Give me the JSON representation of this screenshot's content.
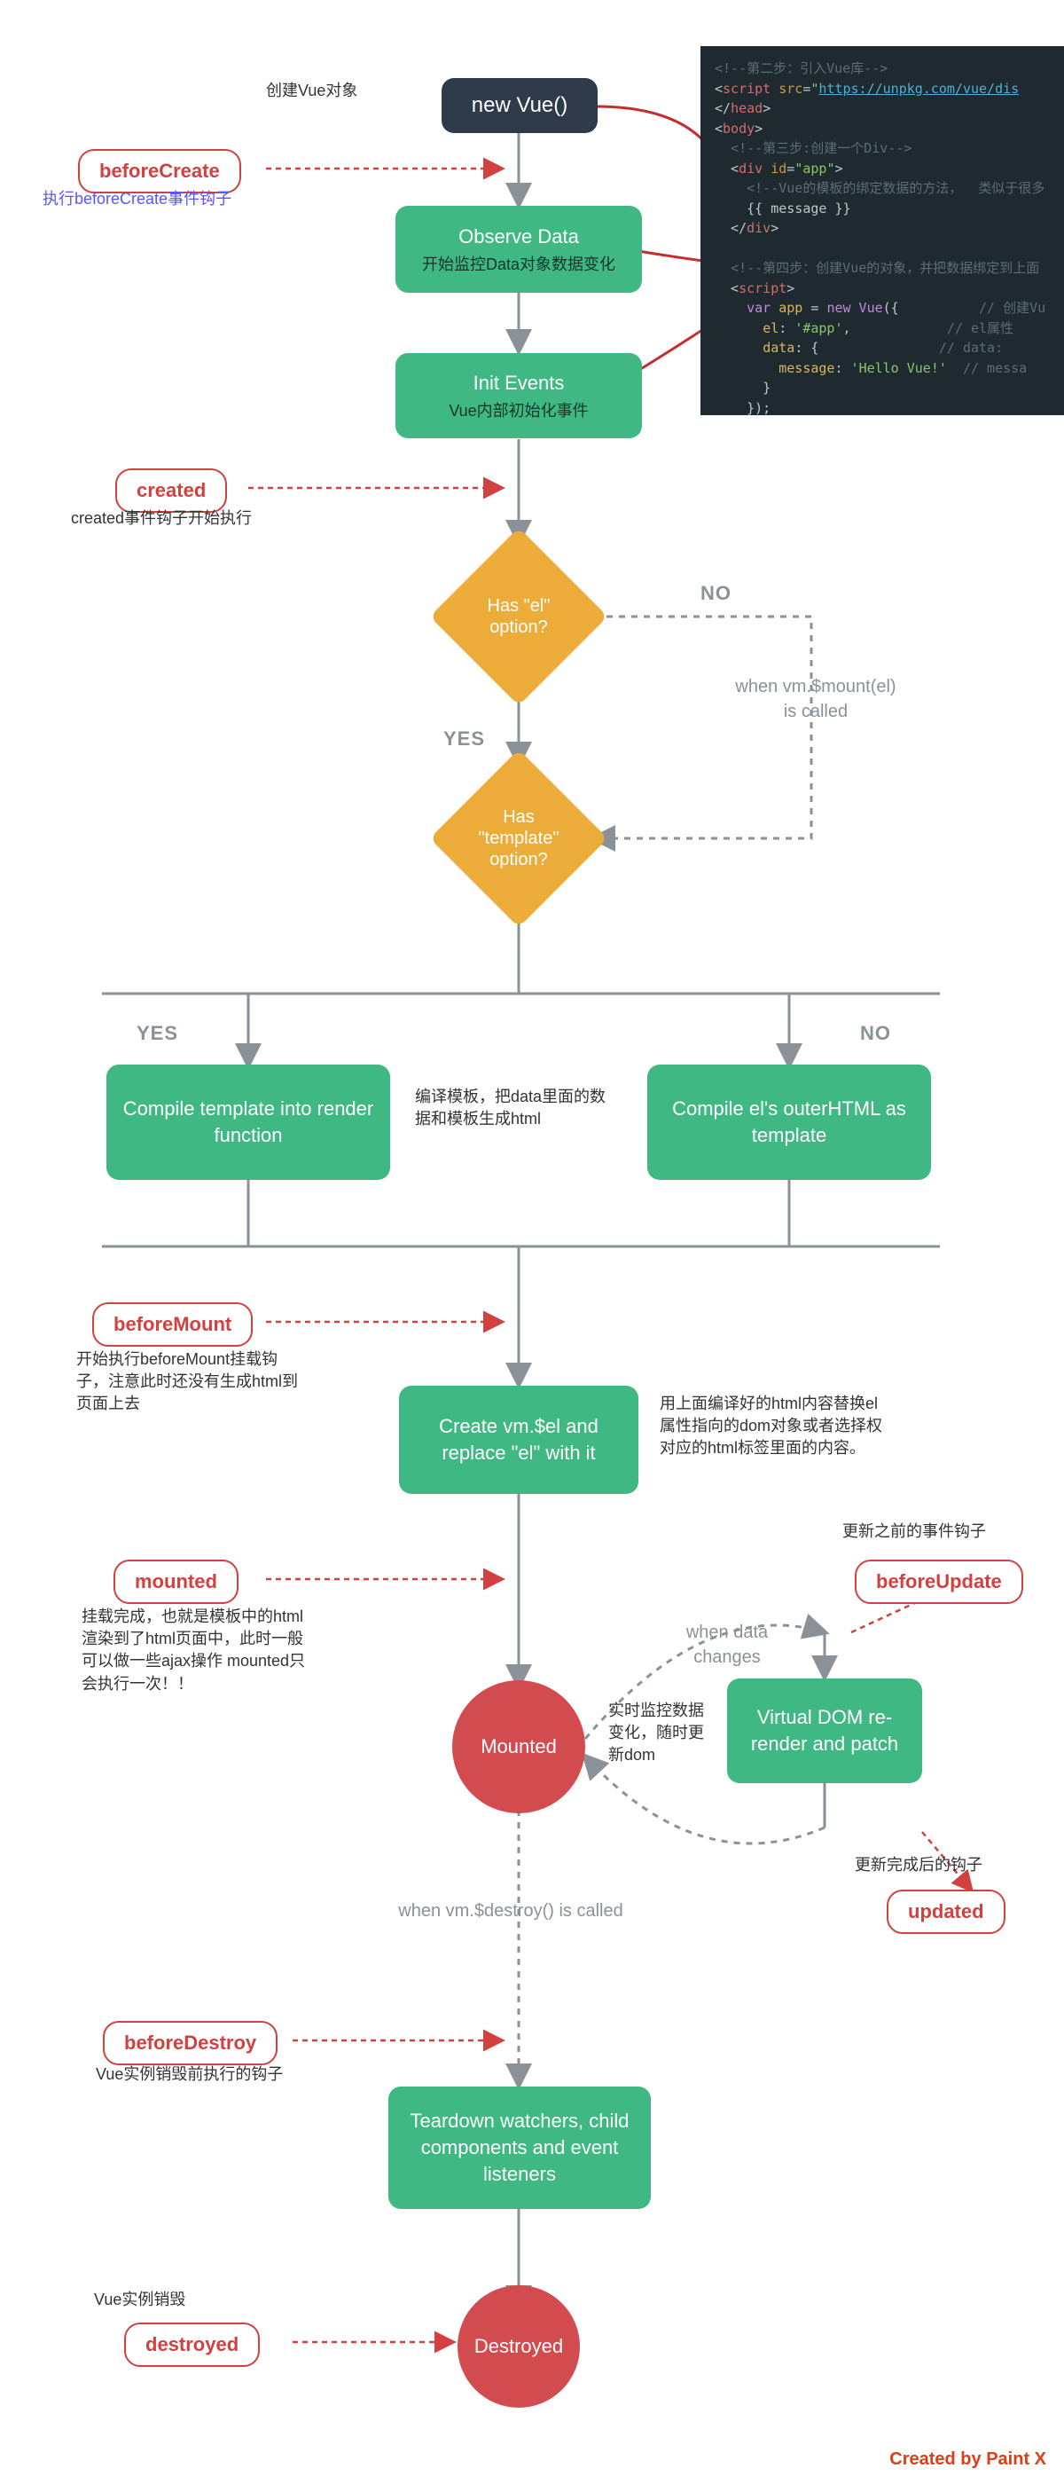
{
  "title_note": "创建Vue对象",
  "nodes": {
    "new_vue": "new Vue()",
    "observe_title": "Observe Data",
    "observe_sub": "开始监控Data对象数据变化",
    "init_events_title": "Init Events",
    "init_events_sub": "Vue内部初始化事件",
    "has_el": "Has \"el\" option?",
    "has_template": "Has \"template\" option?",
    "compile_tmpl": "Compile template into render function",
    "compile_tmpl_note": "编译模板，把data里面的数据和模板生成html",
    "compile_el": "Compile el's outerHTML as template",
    "create_el": "Create vm.$el and replace \"el\" with it",
    "create_el_note": "用上面编译好的html内容替换el属性指向的dom对象或者选择权对应的html标签里面的内容。",
    "virtual_dom": "Virtual DOM re-render and patch",
    "teardown": "Teardown watchers, child components and event listeners",
    "mounted_circle": "Mounted",
    "destroyed_circle": "Destroyed"
  },
  "hooks": {
    "beforeCreate": "beforeCreate",
    "beforeCreate_note": "执行beforeCreate事件钩子",
    "created": "created",
    "created_note": "created事件钩子开始执行",
    "beforeMount": "beforeMount",
    "beforeMount_note": "开始执行beforeMount挂载钩子，注意此时还没有生成html到页面上去",
    "mounted": "mounted",
    "mounted_note": "挂载完成，也就是模板中的html渲染到了html页面中，此时一般可以做一些ajax操作 mounted只会执行一次！！",
    "beforeUpdate": "beforeUpdate",
    "beforeUpdate_note": "更新之前的事件钩子",
    "updated": "updated",
    "updated_note": "更新完成后的钩子",
    "beforeDestroy": "beforeDestroy",
    "beforeDestroy_note": "Vue实例销毁前执行的钩子",
    "destroyed": "destroyed",
    "destroyed_note": "Vue实例销毁"
  },
  "labels": {
    "yes1": "YES",
    "no1": "NO",
    "yes2": "YES",
    "no2": "NO",
    "mount_wait": "when vm.$mount(el) is called",
    "data_changes": "when data changes",
    "data_changes_note": "实时监控数据变化，随时更新dom",
    "destroy_wait": "when vm.$destroy() is called"
  },
  "code": {
    "c2": "<!--第二步：引入Vue库-->",
    "src": "https://unpkg.com/vue/dis",
    "c3": "<!--第三步:创建一个Div-->",
    "c3b": "<!--Vue的模板的绑定数据的方法，  类似于很多",
    "msg": "{{ message }}",
    "c4": "<!--第四步：创建Vue的对象，并把数据绑定到上面",
    "new_vue": "new Vue",
    "cm1": "// 创建Vu",
    "cm2": "// el属性",
    "cm3": "// data:",
    "cm4": "// messa",
    "app_id": "app",
    "el_sel": "#app",
    "hello": "Hello Vue!"
  },
  "footer": "Created by Paint X"
}
